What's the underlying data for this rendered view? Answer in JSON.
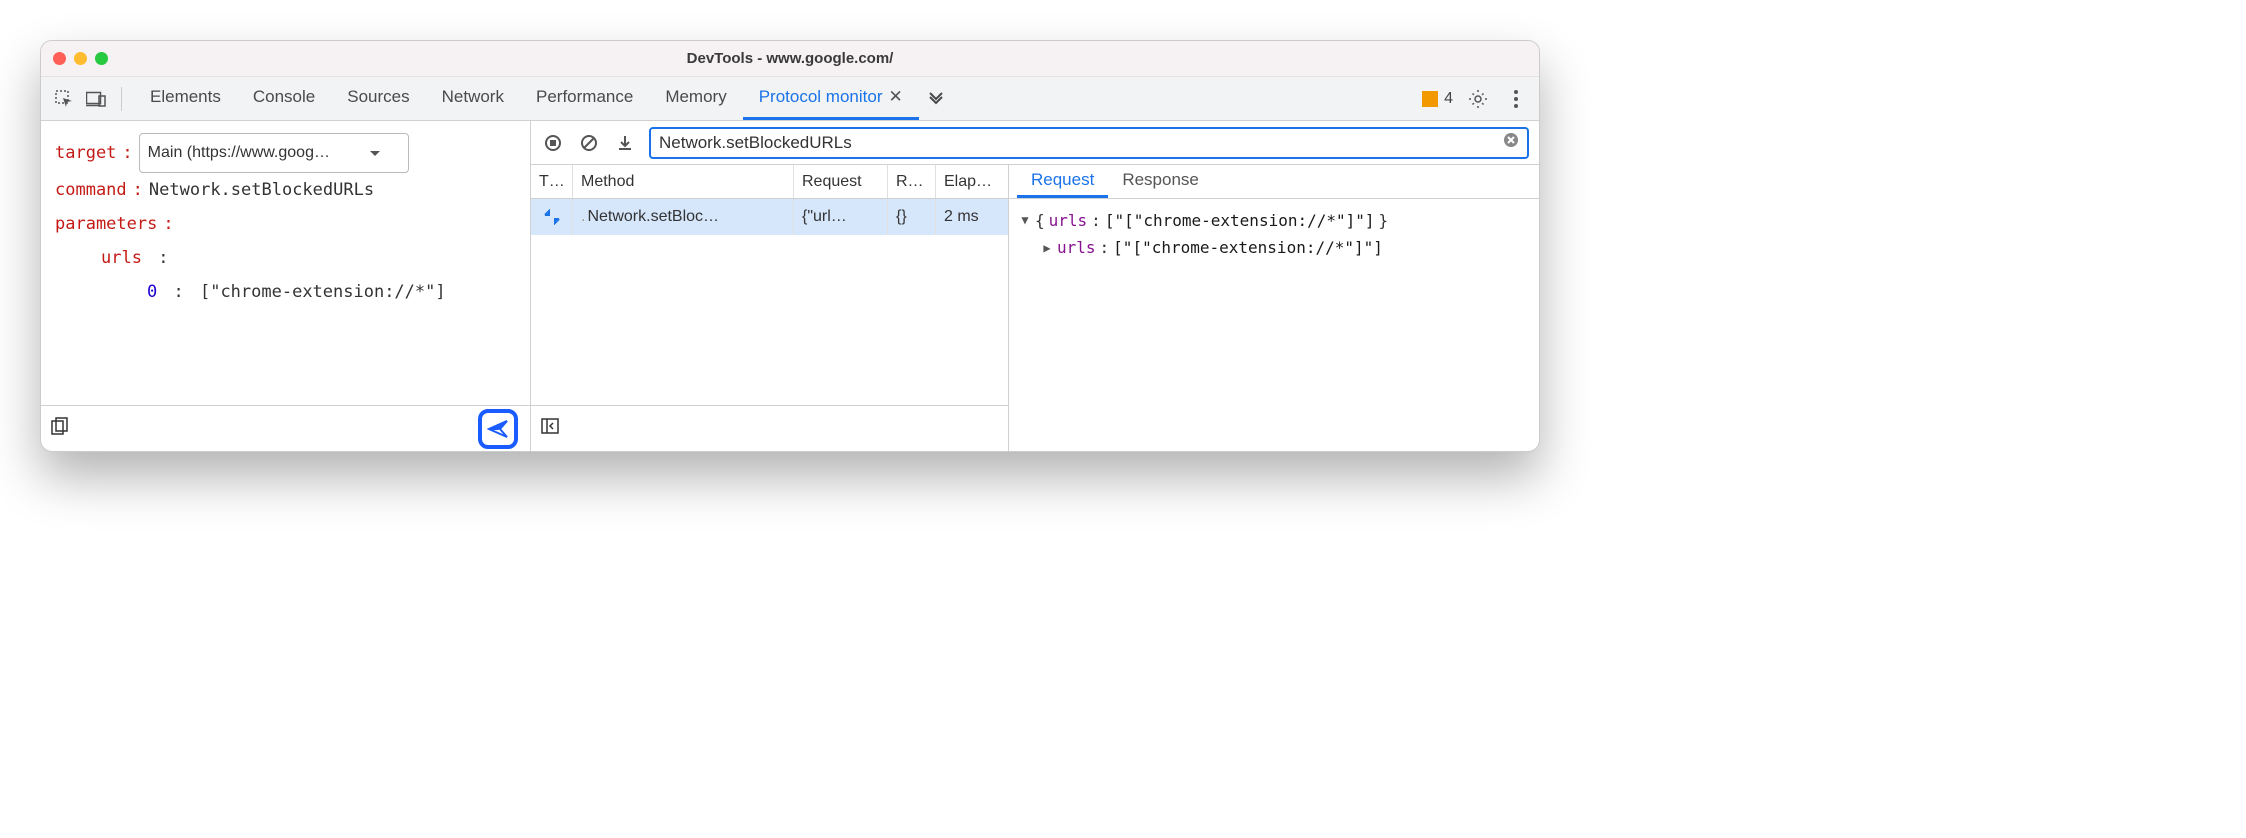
{
  "window": {
    "title": "DevTools - www.google.com/"
  },
  "toolbar": {
    "tabs": [
      "Elements",
      "Console",
      "Sources",
      "Network",
      "Performance",
      "Memory",
      "Protocol monitor"
    ],
    "active_tab": "Protocol monitor",
    "issues_count": "4"
  },
  "left": {
    "target_label": "target",
    "target_value": "Main (https://www.goog…",
    "command_label": "command",
    "command_value": "Network.setBlockedURLs",
    "parameters_label": "parameters",
    "param_urls_key": "urls",
    "param_index": "0",
    "param_value": "[\"chrome-extension://*\"]"
  },
  "filter": {
    "value": "Network.setBlockedURLs"
  },
  "table": {
    "headers": {
      "type": "T…",
      "method": "Method",
      "request": "Request",
      "response": "R…",
      "elapsed": "Elap…"
    },
    "rows": [
      {
        "method": "Network.setBloc…",
        "request": "{\"url…",
        "response": "{}",
        "elapsed": "2 ms"
      }
    ]
  },
  "details": {
    "tabs": {
      "request": "Request",
      "response": "Response"
    },
    "line1_prop": "urls",
    "line1_text": "[\"[\"chrome-extension://*\"]\"]",
    "line2_prop": "urls",
    "line2_text": "[\"[\"chrome-extension://*\"]\"]"
  }
}
